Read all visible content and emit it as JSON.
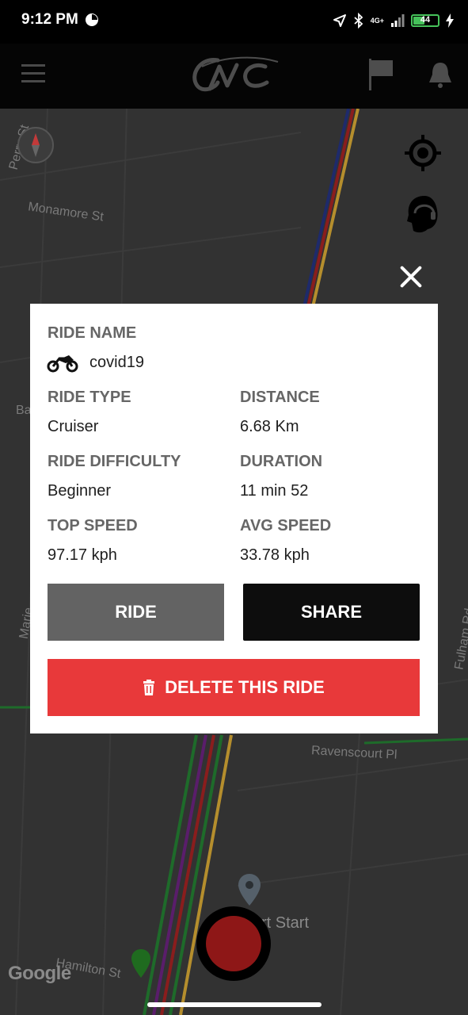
{
  "status_bar": {
    "time": "9:12 PM",
    "battery": "44",
    "network": "4G+"
  },
  "header": {
    "logo_text": "CNC"
  },
  "map": {
    "street_labels": [
      "Perry St",
      "Monamore St",
      "Ba",
      "Marie",
      "Fulham Rd",
      "Ravenscourt Pl",
      "Hamilton St",
      "rt Start"
    ],
    "attribution": "Google"
  },
  "modal": {
    "ride_name_label": "RIDE NAME",
    "ride_name": "covid19",
    "ride_type_label": "RIDE TYPE",
    "ride_type": "Cruiser",
    "distance_label": "DISTANCE",
    "distance": "6.68 Km",
    "ride_difficulty_label": "RIDE DIFFICULTY",
    "ride_difficulty": "Beginner",
    "duration_label": "DURATION",
    "duration": "11 min 52",
    "top_speed_label": "TOP SPEED",
    "top_speed": "97.17 kph",
    "avg_speed_label": "AVG SPEED",
    "avg_speed": "33.78 kph",
    "ride_button": "RIDE",
    "share_button": "SHARE",
    "delete_button": "DELETE THIS RIDE"
  },
  "colors": {
    "delete": "#e8393a",
    "ride_button": "#636363",
    "share_button": "#0d0d0d",
    "battery": "#46c25a"
  }
}
